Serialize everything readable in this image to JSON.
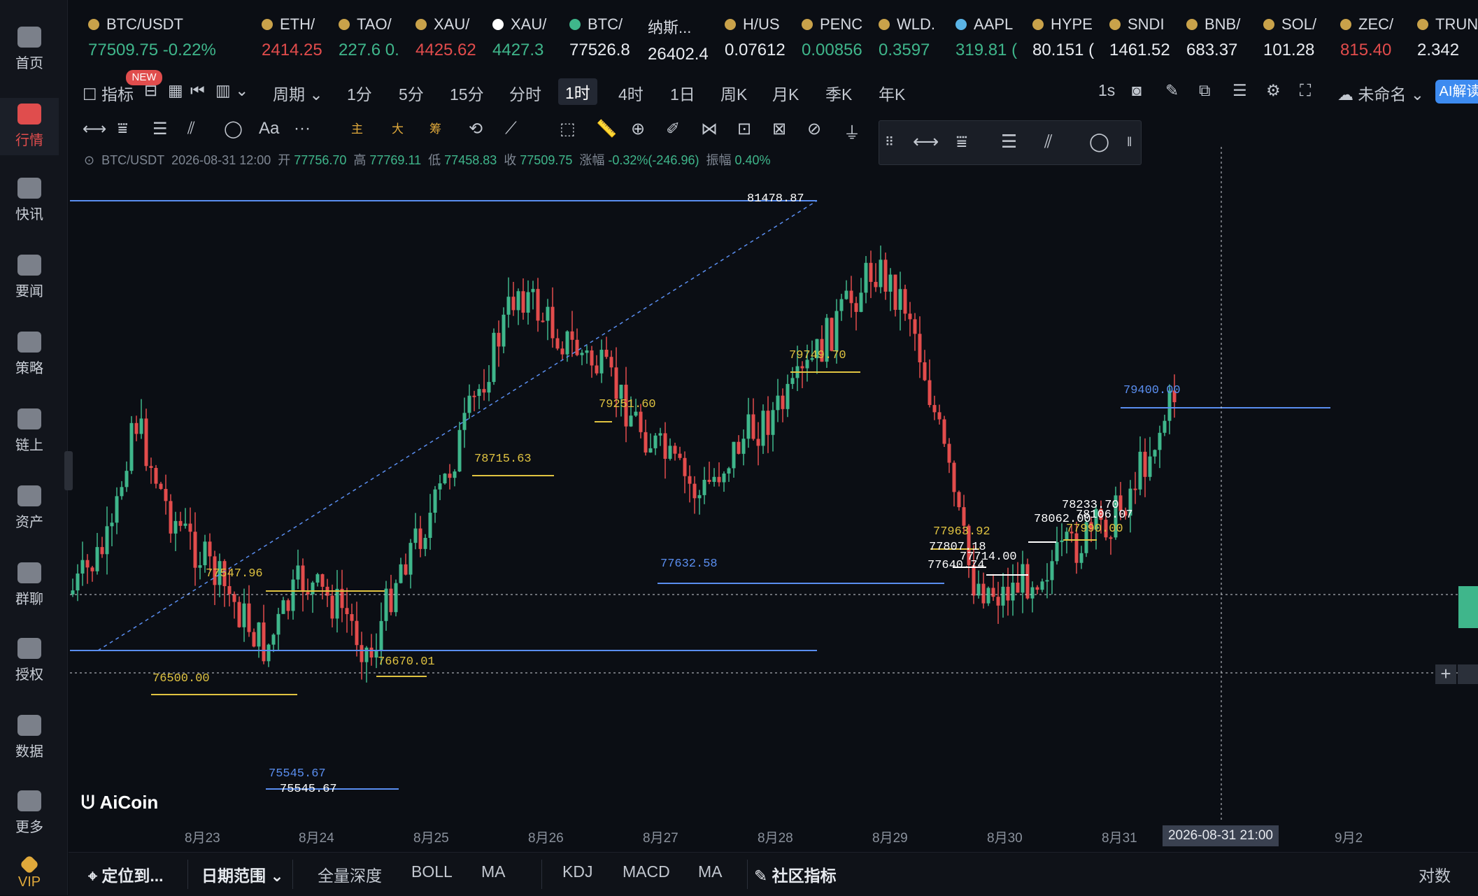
{
  "sidebar": {
    "items": [
      {
        "label": "首页",
        "icon": "home-icon"
      },
      {
        "label": "行情",
        "icon": "market-chart-icon",
        "active": true
      },
      {
        "label": "快讯",
        "icon": "flash-news-icon"
      },
      {
        "label": "要闻",
        "icon": "news-icon"
      },
      {
        "label": "策略",
        "icon": "robot-strategy-icon"
      },
      {
        "label": "链上",
        "icon": "onchain-icon"
      },
      {
        "label": "资产",
        "icon": "wallet-icon"
      },
      {
        "label": "群聊",
        "icon": "chat-icon"
      },
      {
        "label": "授权",
        "icon": "authorize-icon"
      },
      {
        "label": "数据",
        "icon": "data-icon"
      },
      {
        "label": "更多",
        "icon": "more-grid-icon"
      },
      {
        "label": "VIP",
        "icon": "vip-diamond-icon"
      }
    ]
  },
  "ticker": [
    {
      "name": "BTC/USDT",
      "price": "77509.75",
      "change": "-0.22%",
      "trend": "dn"
    },
    {
      "name": "ETH/",
      "price": "2414.25",
      "trend": "dn"
    },
    {
      "name": "TAO/",
      "price": "227.6 0.",
      "trend": "up"
    },
    {
      "name": "XAU/",
      "price": "4425.62",
      "trend": "dn"
    },
    {
      "name": "XAU/",
      "price": "4427.3",
      "trend": "up"
    },
    {
      "name": "BTC/",
      "price": "77526.8",
      "trend": "wt"
    },
    {
      "name": "纳斯...",
      "price": "26402.4",
      "trend": "wt"
    },
    {
      "name": "H/US",
      "price": "0.07612",
      "trend": "wt"
    },
    {
      "name": "PENC",
      "price": "0.00856",
      "trend": "up"
    },
    {
      "name": "WLD.",
      "price": "0.3597",
      "trend": "up"
    },
    {
      "name": "AAPL",
      "price": "319.81 (",
      "trend": "up"
    },
    {
      "name": "HYPE",
      "price": "80.151 (",
      "trend": "wt"
    },
    {
      "name": "SNDI",
      "price": "1461.52",
      "trend": "wt"
    },
    {
      "name": "BNB/",
      "price": "683.37",
      "trend": "wt"
    },
    {
      "name": "SOL/",
      "price": "101.28",
      "trend": "wt"
    },
    {
      "name": "ZEC/",
      "price": "815.40",
      "trend": "dn"
    },
    {
      "name": "TRUN",
      "price": "2.342",
      "trend": "wt"
    }
  ],
  "toolbar": {
    "indicator_label": "指标",
    "new_badge": "NEW",
    "period_label": "周期",
    "intervals": [
      "1分",
      "5分",
      "15分",
      "分时",
      "1时",
      "4时",
      "1日",
      "周K",
      "月K",
      "季K",
      "年K"
    ],
    "selected_interval": "1时",
    "refresh": "1s",
    "layout_name": "未命名",
    "ai_label": "AI解读",
    "draw_text_tools": [
      "主",
      "大",
      "筹"
    ],
    "font_tool": "Aa"
  },
  "info_line": {
    "symbol": "BTC/USDT",
    "datetime": "2026-08-31 12:00",
    "open_label": "开",
    "open": "77756.70",
    "high_label": "高",
    "high": "77769.11",
    "low_label": "低",
    "low": "77458.83",
    "close_label": "收",
    "close": "77509.75",
    "change_label": "涨幅",
    "change": "-0.32%(-246.96)",
    "amp_label": "振幅",
    "amp": "0.40%"
  },
  "chart_data": {
    "type": "candlestick",
    "symbol": "BTC/USDT",
    "interval": "1时",
    "x_labels": [
      "8月23",
      "8月24",
      "8月25",
      "8月26",
      "8月27",
      "8月28",
      "8月29",
      "8月30",
      "8月31",
      "9月2"
    ],
    "crosshair_label": "2026-08-31 21:00",
    "annotations": [
      {
        "text": "81478.87",
        "color": "#ffffff"
      },
      {
        "text": "79749.70",
        "color": "#e0c341"
      },
      {
        "text": "79400.00",
        "color": "#5a8ef0"
      },
      {
        "text": "79251.60",
        "color": "#e0c341"
      },
      {
        "text": "78715.63",
        "color": "#e0c341"
      },
      {
        "text": "78233.70",
        "color": "#ffffff"
      },
      {
        "text": "78106.07",
        "color": "#ffffff"
      },
      {
        "text": "78062.00",
        "color": "#ffffff"
      },
      {
        "text": "77990.00",
        "color": "#e0c341"
      },
      {
        "text": "77963.92",
        "color": "#e0c341"
      },
      {
        "text": "77807.18",
        "color": "#ffffff"
      },
      {
        "text": "77714.00",
        "color": "#ffffff"
      },
      {
        "text": "77640.74",
        "color": "#ffffff"
      },
      {
        "text": "77632.58",
        "color": "#5a8ef0"
      },
      {
        "text": "77547.96",
        "color": "#e0c341"
      },
      {
        "text": "76670.01",
        "color": "#e0c341"
      },
      {
        "text": "76500.00",
        "color": "#e0c341"
      },
      {
        "text": "75545.67",
        "color": "#5a8ef0"
      },
      {
        "text": "75545.67",
        "color": "#ffffff"
      }
    ],
    "colors": {
      "up": "#3fb68b",
      "down": "#e24c4c",
      "background": "#0b0e14"
    },
    "grid": false
  },
  "watermark": "AiCoin",
  "bottom_bar": {
    "locate": "定位到...",
    "date_range": "日期范围",
    "items": [
      "全量深度",
      "BOLL",
      "MA",
      "KDJ",
      "MACD",
      "MA"
    ],
    "community": "社区指标",
    "log_scale": "对数"
  }
}
